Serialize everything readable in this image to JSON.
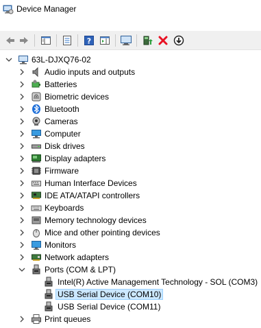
{
  "window": {
    "title": "Device Manager"
  },
  "toolbar": {
    "buttons": [
      {
        "name": "back-button",
        "icon": "arrow-left-icon"
      },
      {
        "name": "forward-button",
        "icon": "arrow-right-icon"
      },
      {
        "name": "show-hide-console-tree-button",
        "icon": "console-tree-icon"
      },
      {
        "name": "properties-button",
        "icon": "properties-icon"
      },
      {
        "name": "help-button",
        "icon": "help-icon"
      },
      {
        "name": "action-pane-button",
        "icon": "action-pane-icon"
      },
      {
        "name": "scan-hardware-button",
        "icon": "monitor-scan-icon"
      },
      {
        "name": "update-driver-button",
        "icon": "update-driver-icon"
      },
      {
        "name": "uninstall-device-button",
        "icon": "red-x-icon"
      },
      {
        "name": "disable-device-button",
        "icon": "down-arrow-circle-icon"
      }
    ]
  },
  "tree": {
    "root": {
      "label": "63L-DJXQ76-02",
      "expanded": true,
      "icon": "computer-icon"
    },
    "categories": [
      {
        "label": "Audio inputs and outputs",
        "icon": "speaker-icon",
        "expanded": false
      },
      {
        "label": "Batteries",
        "icon": "battery-icon",
        "expanded": false
      },
      {
        "label": "Biometric devices",
        "icon": "fingerprint-icon",
        "expanded": false
      },
      {
        "label": "Bluetooth",
        "icon": "bluetooth-icon",
        "expanded": false
      },
      {
        "label": "Cameras",
        "icon": "camera-icon",
        "expanded": false
      },
      {
        "label": "Computer",
        "icon": "computer-icon",
        "expanded": false
      },
      {
        "label": "Disk drives",
        "icon": "disk-drive-icon",
        "expanded": false
      },
      {
        "label": "Display adapters",
        "icon": "display-adapter-icon",
        "expanded": false
      },
      {
        "label": "Firmware",
        "icon": "firmware-icon",
        "expanded": false
      },
      {
        "label": "Human Interface Devices",
        "icon": "hid-icon",
        "expanded": false
      },
      {
        "label": "IDE ATA/ATAPI controllers",
        "icon": "ide-controller-icon",
        "expanded": false
      },
      {
        "label": "Keyboards",
        "icon": "keyboard-icon",
        "expanded": false
      },
      {
        "label": "Memory technology devices",
        "icon": "memory-icon",
        "expanded": false
      },
      {
        "label": "Mice and other pointing devices",
        "icon": "mouse-icon",
        "expanded": false
      },
      {
        "label": "Monitors",
        "icon": "monitor-icon",
        "expanded": false
      },
      {
        "label": "Network adapters",
        "icon": "network-adapter-icon",
        "expanded": false
      },
      {
        "label": "Ports (COM & LPT)",
        "icon": "port-icon",
        "expanded": true,
        "children": [
          {
            "label": "Intel(R) Active Management Technology - SOL (COM3)",
            "icon": "port-icon",
            "selected": false
          },
          {
            "label": "USB Serial Device (COM10)",
            "icon": "port-icon",
            "selected": true
          },
          {
            "label": "USB Serial Device (COM11)",
            "icon": "port-icon",
            "selected": false
          }
        ]
      },
      {
        "label": "Print queues",
        "icon": "printer-icon",
        "expanded": false
      }
    ]
  },
  "colors": {
    "selection_bg": "#cce8ff",
    "selection_border": "#99d1ff",
    "toolbar_bg": "#f0f0f0",
    "accent_blue": "#1e6fd9",
    "uninstall_red": "#e81123"
  }
}
